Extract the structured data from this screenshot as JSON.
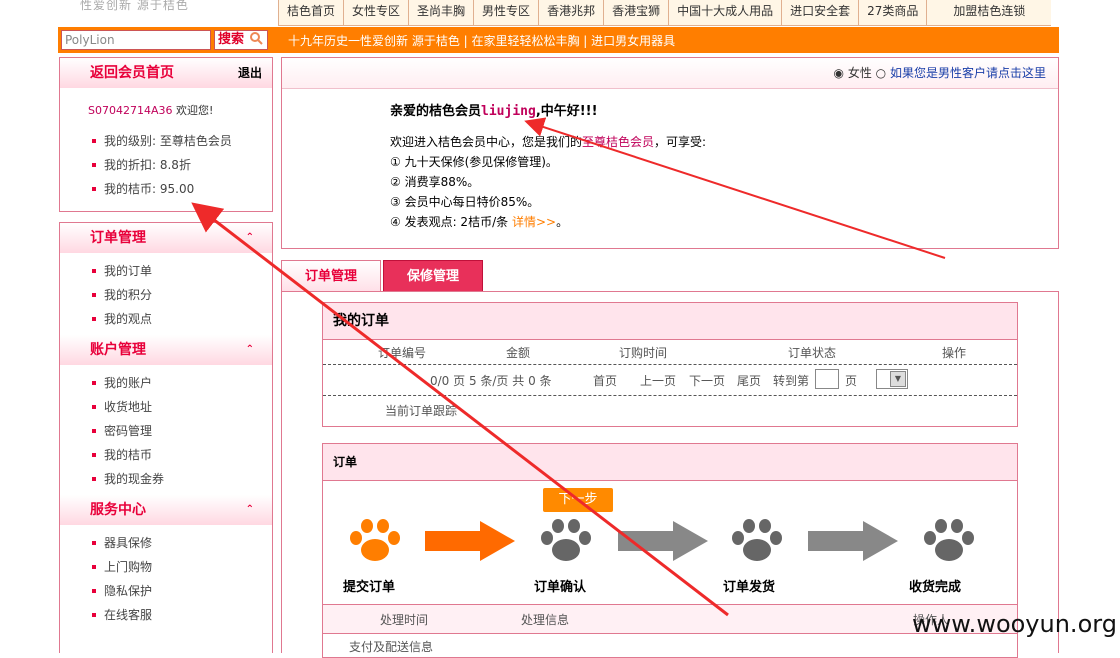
{
  "header": {
    "logo_text": "性爱创新   源于桔色",
    "nav": [
      "桔色首页",
      "女性专区",
      "圣尚丰胸",
      "男性专区",
      "香港兆邦",
      "香港宝狮",
      "中国十大成人用品",
      "进口安全套",
      "27类商品",
      "加盟桔色连锁"
    ],
    "search_placeholder": "PolyLion",
    "search_button": "搜索",
    "tagline": "十九年历史一性爱创新  源于桔色 | 在家里轻轻松松丰胸 | 进口男女用器具"
  },
  "sidebar": {
    "member": {
      "title": "返回会员首页",
      "logout": "退出",
      "user_id": "S07042714A36",
      "welcome": "欢迎您!",
      "items": [
        "我的级别: 至尊桔色会员",
        "我的折扣: 8.8折",
        "我的桔币: 95.00"
      ]
    },
    "sections": [
      {
        "title": "订单管理",
        "items": [
          "我的订单",
          "我的积分",
          "我的观点"
        ]
      },
      {
        "title": "账户管理",
        "items": [
          "我的账户",
          "收货地址",
          "密码管理",
          "我的桔币",
          "我的现金券"
        ]
      },
      {
        "title": "服务中心",
        "items": [
          "器具保修",
          "上门购物",
          "隐私保护",
          "在线客服"
        ]
      }
    ]
  },
  "main": {
    "gender_female": "女性",
    "gender_male_link": "如果您是男性客户请点击这里",
    "greeting_prefix": "亲爱的桔色会员",
    "greeting_user": "liujing",
    "greeting_suffix": ",中午好!!!",
    "intro_a": "欢迎进入桔色会员中心，您是我们的",
    "intro_level": "至尊桔色会员",
    "intro_b": "，可享受:",
    "benefits": [
      "① 九十天保修(参见保修管理)。",
      "② 消费享88%。",
      "③ 会员中心每日特价85%。",
      "④ 发表观点: 2桔币/条 "
    ],
    "details_link": "详情>>",
    "details_tail": "。",
    "tabs": [
      "订单管理",
      "保修管理"
    ],
    "orders": {
      "title": "我的订单",
      "columns": [
        "订单编号",
        "金额",
        "订购时间",
        "订单状态",
        "操作"
      ],
      "pager": "0/0 页 5 条/页  共 0 条",
      "first": "首页",
      "prev": "上一页",
      "next": "下一页",
      "last": "尾页",
      "goto": "转到第",
      "page_unit": "页",
      "tracking": "当前订单跟踪"
    },
    "flow": {
      "title": "订单",
      "next_step": "下一步",
      "steps": [
        "提交订单",
        "订单确认",
        "订单发货",
        "收货完成"
      ],
      "cols": [
        "处理时间",
        "处理信息",
        "操作人"
      ],
      "bottom": "支付及配送信息"
    }
  },
  "watermark": "www.wooyun.org"
}
